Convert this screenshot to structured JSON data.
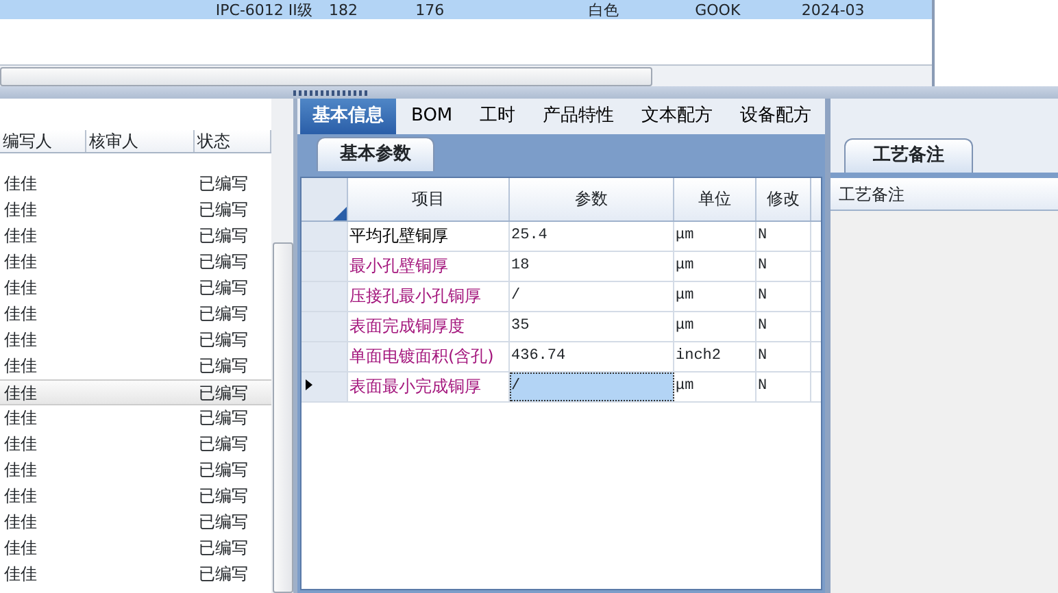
{
  "top_grid": {
    "row": {
      "selected": true,
      "cells": [
        "IPC-6012 II级",
        "182",
        "176",
        "白色",
        "GOOK",
        "2024-03"
      ]
    }
  },
  "list": {
    "columns": [
      "编写人",
      "核审人",
      "状态"
    ],
    "rows": [
      {
        "cells": [
          "佳佳",
          "",
          "已编写"
        ],
        "selected": false
      },
      {
        "cells": [
          "佳佳",
          "",
          "已编写"
        ],
        "selected": false
      },
      {
        "cells": [
          "佳佳",
          "",
          "已编写"
        ],
        "selected": false
      },
      {
        "cells": [
          "佳佳",
          "",
          "已编写"
        ],
        "selected": false
      },
      {
        "cells": [
          "佳佳",
          "",
          "已编写"
        ],
        "selected": false
      },
      {
        "cells": [
          "佳佳",
          "",
          "已编写"
        ],
        "selected": false
      },
      {
        "cells": [
          "佳佳",
          "",
          "已编写"
        ],
        "selected": false
      },
      {
        "cells": [
          "佳佳",
          "",
          "已编写"
        ],
        "selected": false
      },
      {
        "cells": [
          "佳佳",
          "",
          "已编写"
        ],
        "selected": true
      },
      {
        "cells": [
          "佳佳",
          "",
          "已编写"
        ],
        "selected": false
      },
      {
        "cells": [
          "佳佳",
          "",
          "已编写"
        ],
        "selected": false
      },
      {
        "cells": [
          "佳佳",
          "",
          "已编写"
        ],
        "selected": false
      },
      {
        "cells": [
          "佳佳",
          "",
          "已编写"
        ],
        "selected": false
      },
      {
        "cells": [
          "佳佳",
          "",
          "已编写"
        ],
        "selected": false
      },
      {
        "cells": [
          "佳佳",
          "",
          "已编写"
        ],
        "selected": false
      },
      {
        "cells": [
          "佳佳",
          "",
          "已编写"
        ],
        "selected": false
      }
    ]
  },
  "tabs": [
    {
      "label": "基本信息",
      "selected": true
    },
    {
      "label": "BOM",
      "selected": false
    },
    {
      "label": "工时",
      "selected": false
    },
    {
      "label": "产品特性",
      "selected": false
    },
    {
      "label": "文本配方",
      "selected": false
    },
    {
      "label": "设备配方",
      "selected": false
    }
  ],
  "sub_tab": "基本参数",
  "params": {
    "columns": [
      "项目",
      "参数",
      "单位",
      "修改"
    ],
    "rows": [
      {
        "item": "平均孔壁铜厚",
        "value": "25.4",
        "unit": "μm",
        "modified": "N",
        "color": "#000000",
        "selected": false
      },
      {
        "item": "最小孔壁铜厚",
        "value": "18",
        "unit": "μm",
        "modified": "N",
        "color": "#a3157c",
        "selected": false
      },
      {
        "item": "压接孔最小孔铜厚",
        "value": "/",
        "unit": "μm",
        "modified": "N",
        "color": "#a3157c",
        "selected": false
      },
      {
        "item": "表面完成铜厚度",
        "value": "35",
        "unit": "μm",
        "modified": "N",
        "color": "#a3157c",
        "selected": false
      },
      {
        "item": "单面电镀面积(含孔)",
        "value": "436.74",
        "unit": "inch2",
        "modified": "N",
        "color": "#a3157c",
        "selected": false
      },
      {
        "item": "表面最小完成铜厚",
        "value": "/",
        "unit": "μm",
        "modified": "N",
        "color": "#a3157c",
        "selected": true
      }
    ]
  },
  "notes": {
    "tab": "工艺备注",
    "header": "工艺备注"
  }
}
